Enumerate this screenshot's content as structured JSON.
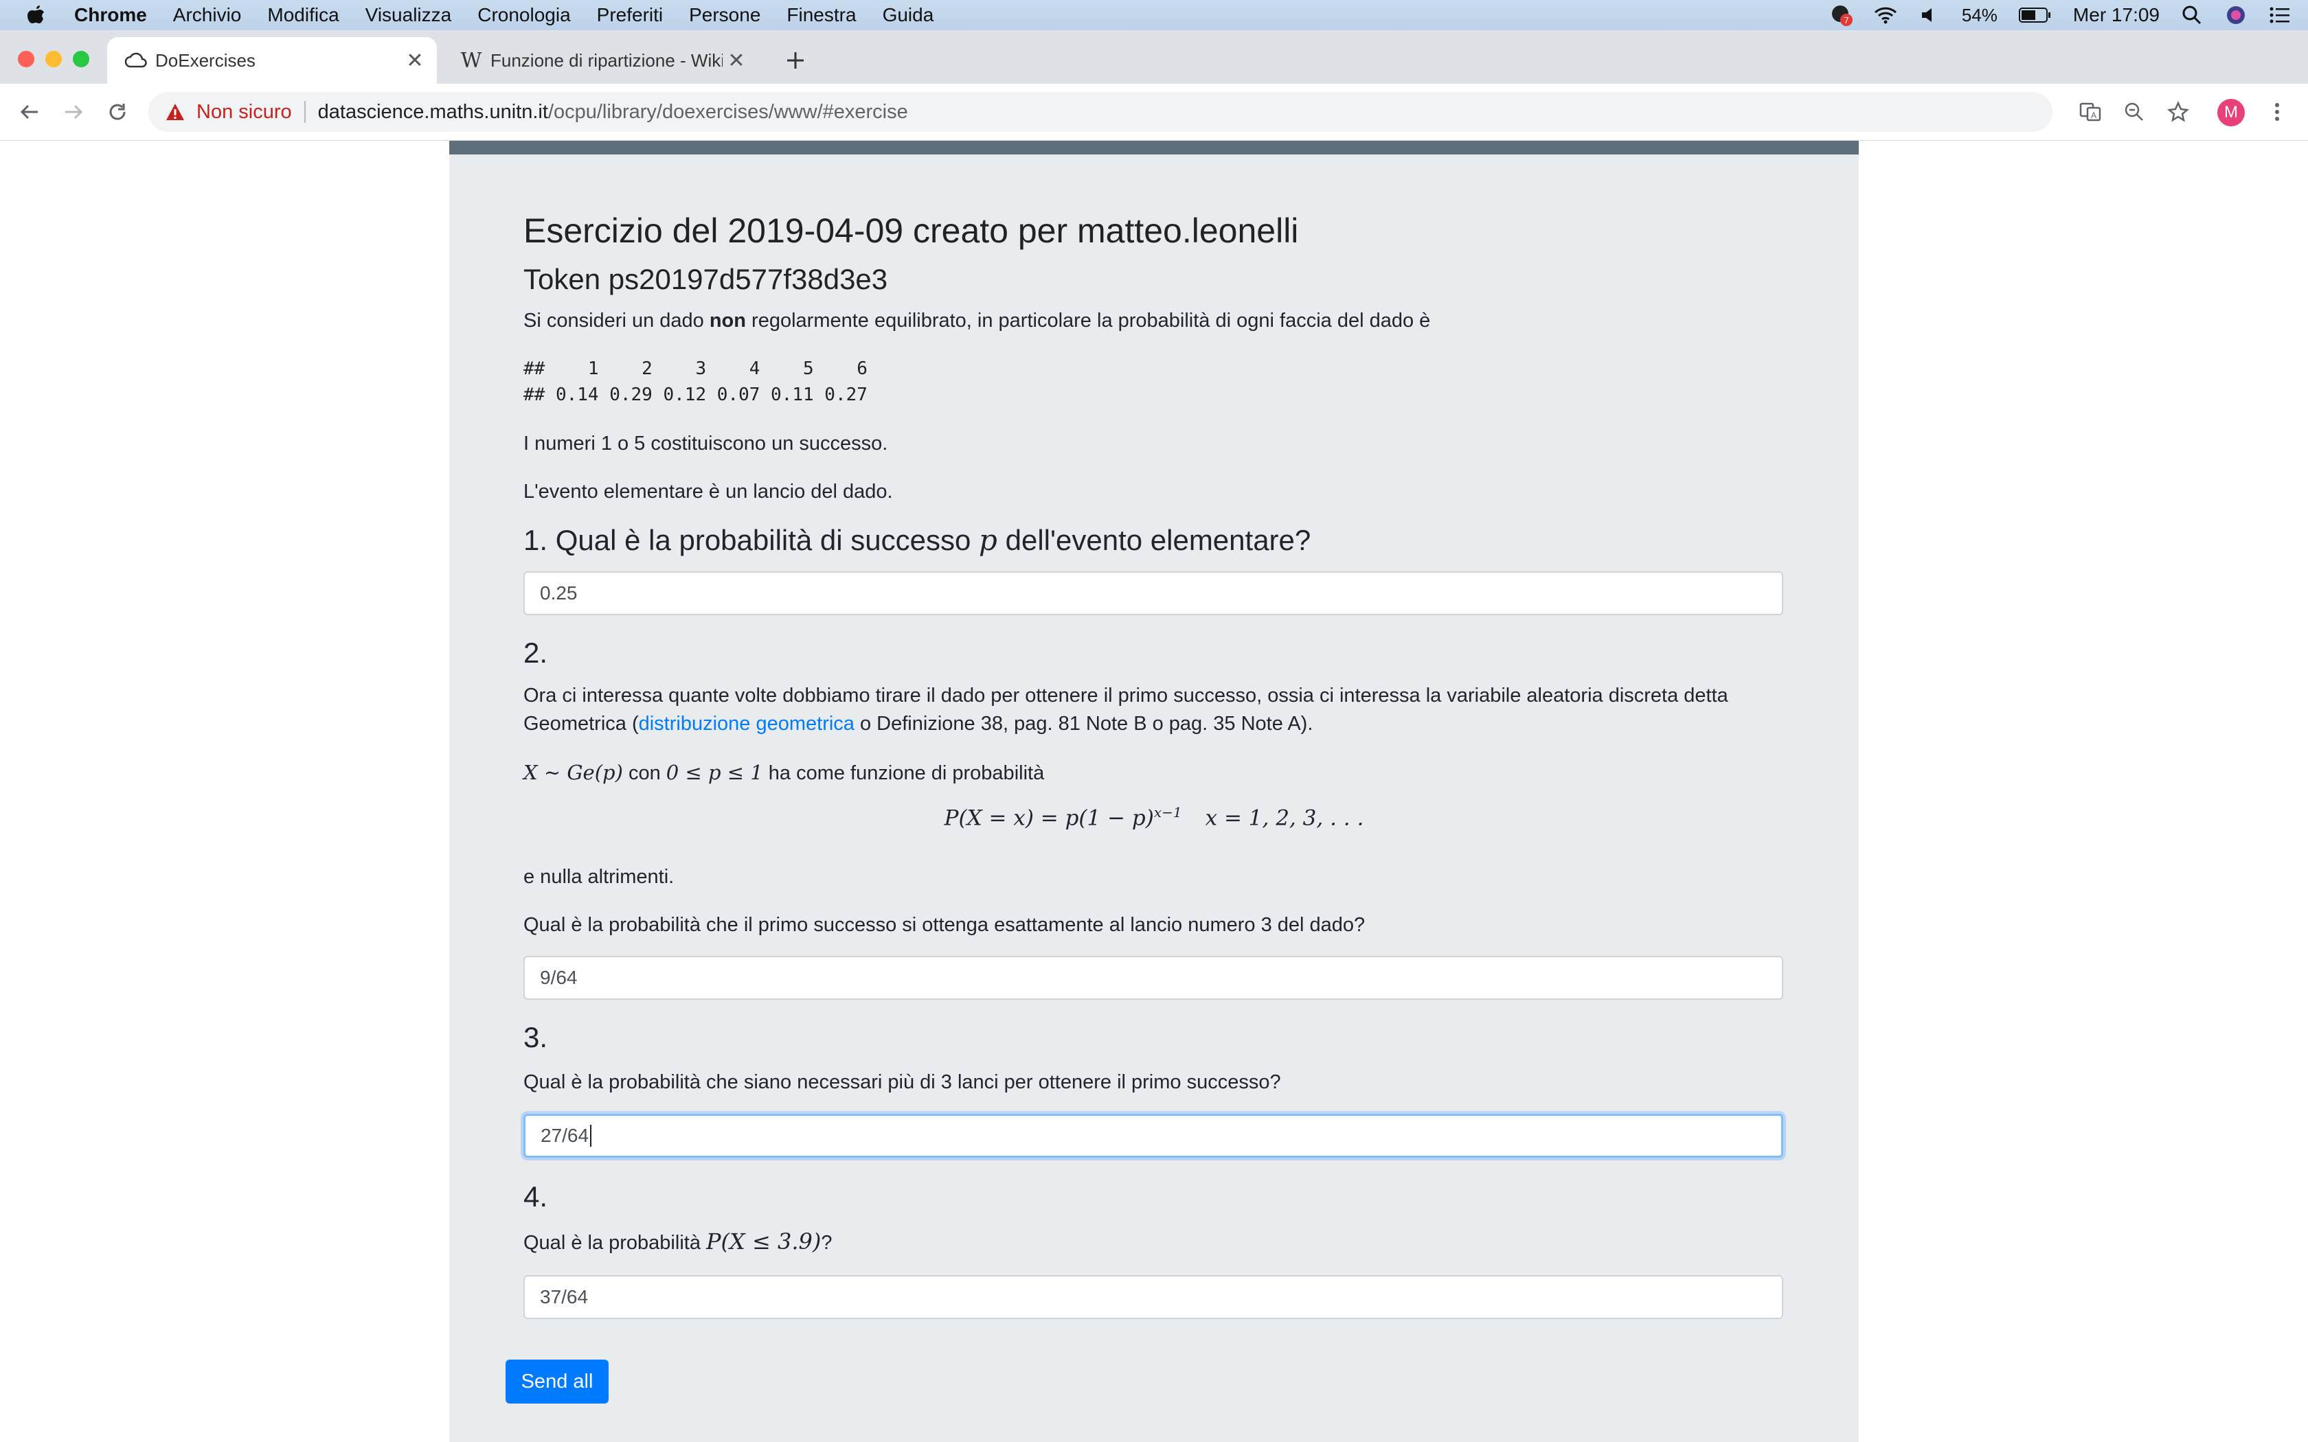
{
  "menubar": {
    "app_name": "Chrome",
    "items": [
      "Archivio",
      "Modifica",
      "Visualizza",
      "Cronologia",
      "Preferiti",
      "Persone",
      "Finestra",
      "Guida"
    ],
    "notification_badge": "7",
    "battery": "54%",
    "clock": "Mer 17:09"
  },
  "tabs": [
    {
      "title": "DoExercises",
      "icon": "cloud-icon"
    },
    {
      "title": "Funzione di ripartizione - Wikipedia",
      "icon": "wikipedia-icon"
    }
  ],
  "omnibox": {
    "security_label": "Non sicuro",
    "host": "datascience.maths.unitn.it",
    "path": "/ocpu/library/doexercises/www/#exercise"
  },
  "profile_initial": "M",
  "exercise": {
    "title": "Esercizio del 2019-04-09 creato per matteo.leonelli",
    "token": "Token ps20197d577f38d3e3",
    "intro_before": "Si consideri un dado ",
    "intro_bold": "non",
    "intro_after": " regolarmente equilibrato, in particolare la probabilità di ogni faccia del dado è",
    "table_line1": "##    1    2    3    4    5    6",
    "table_line2": "## 0.14 0.29 0.12 0.07 0.11 0.27",
    "success_text": "I numeri 1 o 5 costituiscono un successo.",
    "event_text": "L'evento elementare è un lancio del dado."
  },
  "questions": {
    "q1_heading_before": "1. Qual è la probabilità di successo ",
    "q1_var": "p",
    "q1_heading_after": " dell'evento elementare?",
    "q1_answer": "0.25",
    "q2_heading": "2.",
    "q2_text_line1": "Ora ci interessa quante volte dobbiamo tirare il dado per ottenere il primo successo, ossia ci interessa la variabile aleatoria discreta detta",
    "q2_text_line2_before": "Geometrica (",
    "q2_link": "distribuzione geometrica",
    "q2_text_line2_after": " o Definizione 38, pag. 81 Note B o pag. 35 Note A).",
    "q2_dist": "X ∼ Ge(p)",
    "q2_con": " con ",
    "q2_range": "0 ≤ p ≤ 1",
    "q2_has_function": " ha come funzione di probabilità",
    "q2_formula": "P(X = x) = p(1 − p)",
    "q2_formula_exp": "x−1",
    "q2_formula_domain": "x = 1, 2, 3, . . .",
    "q2_otherwise": "e nulla altrimenti.",
    "q2_question": "Qual è la probabilità che il primo successo si ottenga esattamente al lancio numero 3 del dado?",
    "q2_answer": "9/64",
    "q3_heading": "3.",
    "q3_question": "Qual è la probabilità che siano necessari più di 3 lanci per ottenere il primo successo?",
    "q3_answer": "27/64",
    "q4_heading": "4.",
    "q4_question_before": "Qual è la probabilità ",
    "q4_expr": "P(X ≤ 3.9)",
    "q4_question_after": "?",
    "q4_answer": "37/64"
  },
  "send_button": "Send all"
}
